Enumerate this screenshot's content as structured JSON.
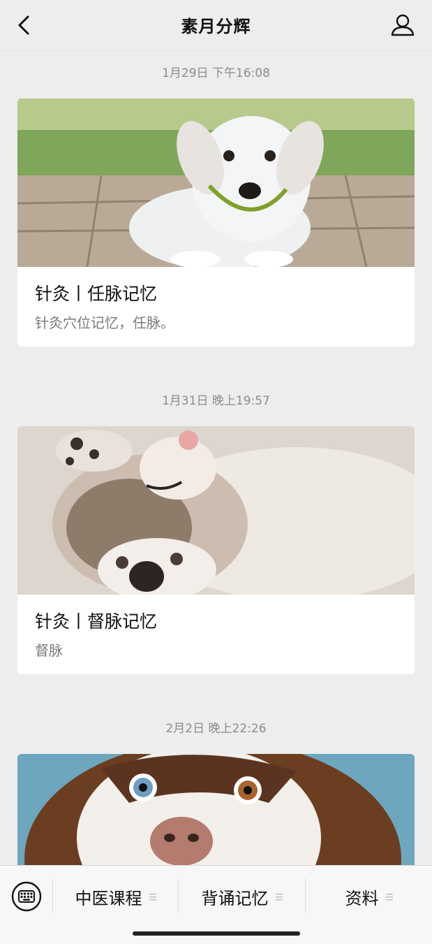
{
  "header": {
    "title": "素月分辉"
  },
  "messages": [
    {
      "time": "1月29日 下午16:08",
      "title": "针灸丨任脉记忆",
      "desc": "针灸穴位记忆，任脉。"
    },
    {
      "time": "1月31日 晚上19:57",
      "title": "针灸丨督脉记忆",
      "desc": "督脉"
    },
    {
      "time": "2月2日 晚上22:26"
    }
  ],
  "menu": {
    "items": [
      {
        "label": "中医课程"
      },
      {
        "label": "背诵记忆"
      },
      {
        "label": "资料"
      }
    ]
  },
  "icons": [
    "back-icon",
    "profile-icon",
    "keyboard-icon",
    "menu-lines-icon"
  ]
}
